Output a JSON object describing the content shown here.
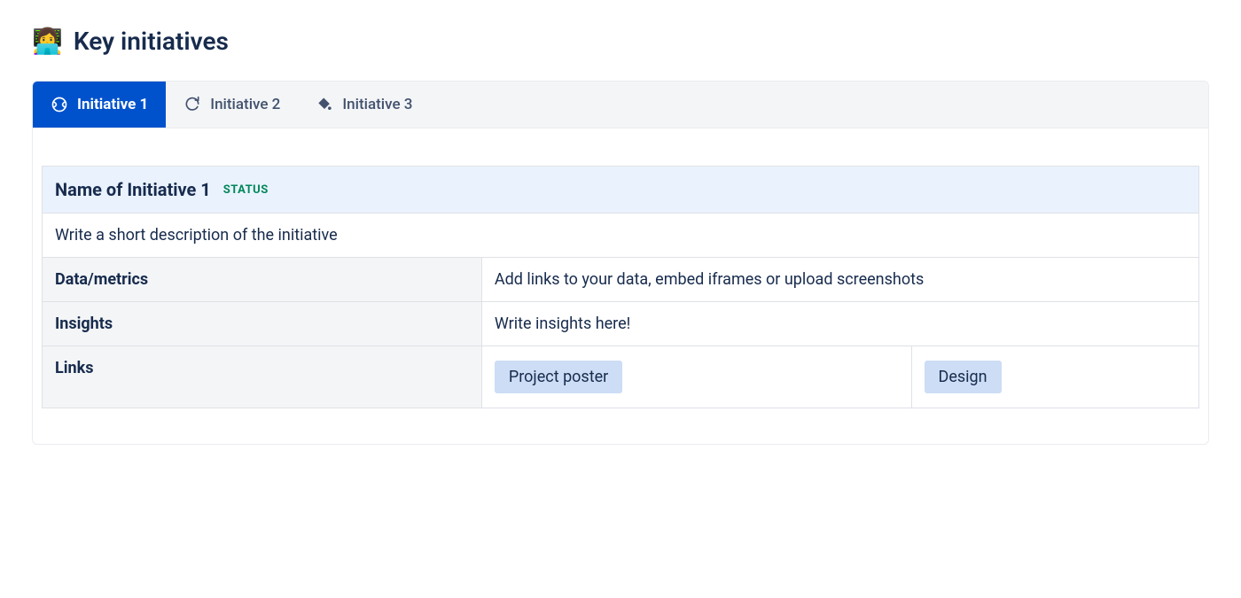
{
  "heading": {
    "emoji": "👩‍💻",
    "title": "Key initiatives"
  },
  "tabs": [
    {
      "label": "Initiative 1",
      "active": true,
      "icon": "tennis-icon"
    },
    {
      "label": "Initiative 2",
      "active": false,
      "icon": "refresh-icon"
    },
    {
      "label": "Initiative 3",
      "active": false,
      "icon": "paint-bucket-icon"
    }
  ],
  "card": {
    "title": "Name of Initiative 1",
    "status": "STATUS",
    "description": "Write a short description of the initiative",
    "rows": [
      {
        "label": "Data/metrics",
        "value": "Add links to your data, embed iframes or upload screenshots"
      },
      {
        "label": "Insights",
        "value": "Write insights here!"
      }
    ],
    "links_label": "Links",
    "links": [
      {
        "label": "Project poster"
      },
      {
        "label": "Design"
      }
    ]
  }
}
